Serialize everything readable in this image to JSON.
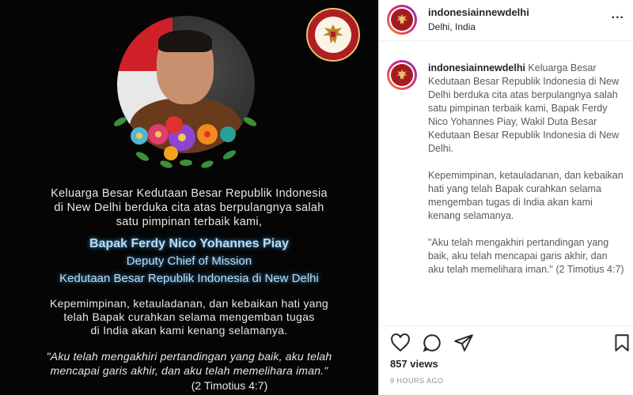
{
  "post_image": {
    "seal_icon": "indonesian-embassy-seal",
    "intro_lines": [
      "Keluarga Besar Kedutaan Besar Republik Indonesia",
      "di New Delhi berduka cita atas berpulangnya salah",
      "satu pimpinan terbaik kami,"
    ],
    "name": "Bapak Ferdy Nico Yohannes Piay",
    "role": "Deputy Chief of Mission",
    "office": "Kedutaan Besar Republik Indonesia di New Delhi",
    "leadership_lines": [
      "Kepemimpinan, ketauladanan, dan kebaikan hati yang",
      "telah Bapak curahkan selama mengemban tugas",
      "di India akan kami kenang selamanya."
    ],
    "quote_lines": [
      "\"Aku telah mengakhiri pertandingan yang baik, aku telah",
      "mencapai garis akhir, dan aku telah memelihara iman.\""
    ],
    "verse": "(2 Timotius 4:7)"
  },
  "header": {
    "username": "indonesiainnewdelhi",
    "location": "Delhi, India",
    "more_icon": "more-options-icon",
    "more_label": "..."
  },
  "caption": {
    "username": "indonesiainnewdelhi",
    "paragraph1": "Keluarga Besar Kedutaan Besar Republik Indonesia di New Delhi berduka cita atas berpulangnya salah satu pimpinan terbaik kami, Bapak Ferdy Nico Yohannes Piay, Wakil Duta Besar Kedutaan Besar Republik Indonesia di New Delhi.",
    "paragraph2": "Kepemimpinan, ketauladanan, dan kebaikan hati yang telah Bapak curahkan selama mengemban tugas di India akan kami kenang selamanya.",
    "paragraph3": "\"Aku telah mengakhiri pertandingan yang baik, aku telah mencapai garis akhir, dan aku telah memelihara iman.\" (2 Timotius 4:7)"
  },
  "actions": {
    "icons": [
      "heart-icon",
      "comment-icon",
      "share-icon",
      "bookmark-icon"
    ],
    "views": "857 views",
    "time": "9 HOURS AGO"
  },
  "colors": {
    "name_glow": "#4aa6e6",
    "name_text": "#b9dcf6",
    "seal_red": "#b01e24"
  }
}
